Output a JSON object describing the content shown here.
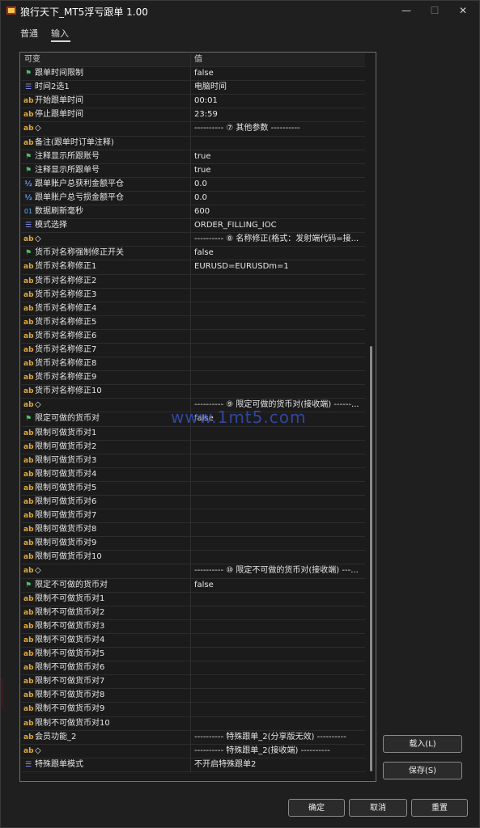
{
  "window": {
    "title": "狼行天下_MT5浮亏跟单 1.00",
    "min_glyph": "—",
    "max_glyph": "☐",
    "close_glyph": "✕"
  },
  "tabs": [
    {
      "label": "普通"
    },
    {
      "label": "输入"
    }
  ],
  "table": {
    "headers": [
      "可变",
      "值"
    ],
    "rows": [
      {
        "icon": "flag",
        "name": "跟单时间限制",
        "value": "false"
      },
      {
        "icon": "enum",
        "name": "时间2选1",
        "value": "电脑时间"
      },
      {
        "icon": "ab",
        "name": "开始跟单时间",
        "value": "00:01"
      },
      {
        "icon": "ab",
        "name": "停止跟单时间",
        "value": "23:59"
      },
      {
        "icon": "ab",
        "name": "◇",
        "value": "---------- ⑦ 其他参数 ----------"
      },
      {
        "icon": "ab",
        "name": "备注(跟单时订单注释)",
        "value": ""
      },
      {
        "icon": "flag",
        "name": "注释显示所跟账号",
        "value": "true"
      },
      {
        "icon": "flag",
        "name": "注释显示所跟单号",
        "value": "true"
      },
      {
        "icon": "half",
        "name": "跟单账户总获利金额平仓",
        "value": "0.0"
      },
      {
        "icon": "half",
        "name": "跟单账户总亏损金额平仓",
        "value": "0.0"
      },
      {
        "icon": "num",
        "name": "数据刷新毫秒",
        "value": "600"
      },
      {
        "icon": "enum",
        "name": "模式选择",
        "value": "ORDER_FILLING_IOC"
      },
      {
        "icon": "ab",
        "name": "◇",
        "value": "---------- ⑧ 名称修正(格式：发射端代码=接..."
      },
      {
        "icon": "flag",
        "name": "货币对名称强制修正开关",
        "value": "false"
      },
      {
        "icon": "ab",
        "name": "货币对名称修正1",
        "value": "EURUSD=EURUSDm=1"
      },
      {
        "icon": "ab",
        "name": "货币对名称修正2",
        "value": ""
      },
      {
        "icon": "ab",
        "name": "货币对名称修正3",
        "value": ""
      },
      {
        "icon": "ab",
        "name": "货币对名称修正4",
        "value": ""
      },
      {
        "icon": "ab",
        "name": "货币对名称修正5",
        "value": ""
      },
      {
        "icon": "ab",
        "name": "货币对名称修正6",
        "value": ""
      },
      {
        "icon": "ab",
        "name": "货币对名称修正7",
        "value": ""
      },
      {
        "icon": "ab",
        "name": "货币对名称修正8",
        "value": ""
      },
      {
        "icon": "ab",
        "name": "货币对名称修正9",
        "value": ""
      },
      {
        "icon": "ab",
        "name": "货币对名称修正10",
        "value": ""
      },
      {
        "icon": "ab",
        "name": "◇",
        "value": "---------- ⑨ 限定可做的货币对(接收端) ------..."
      },
      {
        "icon": "flag",
        "name": "限定可做的货币对",
        "value": "false"
      },
      {
        "icon": "ab",
        "name": "限制可做货币对1",
        "value": ""
      },
      {
        "icon": "ab",
        "name": "限制可做货币对2",
        "value": ""
      },
      {
        "icon": "ab",
        "name": "限制可做货币对3",
        "value": ""
      },
      {
        "icon": "ab",
        "name": "限制可做货币对4",
        "value": ""
      },
      {
        "icon": "ab",
        "name": "限制可做货币对5",
        "value": ""
      },
      {
        "icon": "ab",
        "name": "限制可做货币对6",
        "value": ""
      },
      {
        "icon": "ab",
        "name": "限制可做货币对7",
        "value": ""
      },
      {
        "icon": "ab",
        "name": "限制可做货币对8",
        "value": ""
      },
      {
        "icon": "ab",
        "name": "限制可做货币对9",
        "value": ""
      },
      {
        "icon": "ab",
        "name": "限制可做货币对10",
        "value": ""
      },
      {
        "icon": "ab",
        "name": "◇",
        "value": "---------- ⑩ 限定不可做的货币对(接收端) ---..."
      },
      {
        "icon": "flag",
        "name": "限定不可做的货币对",
        "value": "false"
      },
      {
        "icon": "ab",
        "name": "限制不可做货币对1",
        "value": ""
      },
      {
        "icon": "ab",
        "name": "限制不可做货币对2",
        "value": ""
      },
      {
        "icon": "ab",
        "name": "限制不可做货币对3",
        "value": ""
      },
      {
        "icon": "ab",
        "name": "限制不可做货币对4",
        "value": ""
      },
      {
        "icon": "ab",
        "name": "限制不可做货币对5",
        "value": ""
      },
      {
        "icon": "ab",
        "name": "限制不可做货币对6",
        "value": ""
      },
      {
        "icon": "ab",
        "name": "限制不可做货币对7",
        "value": ""
      },
      {
        "icon": "ab",
        "name": "限制不可做货币对8",
        "value": ""
      },
      {
        "icon": "ab",
        "name": "限制不可做货币对9",
        "value": ""
      },
      {
        "icon": "ab",
        "name": "限制不可做货币对10",
        "value": ""
      },
      {
        "icon": "ab",
        "name": "会员功能_2",
        "value": "---------- 特殊跟单_2(分享版无效) ----------"
      },
      {
        "icon": "ab",
        "name": "◇",
        "value": "---------- 特殊跟单_2(接收端) ----------"
      },
      {
        "icon": "enum",
        "name": "特殊跟单模式",
        "value": "不开启特殊跟单2"
      }
    ]
  },
  "icons": {
    "ab": "ab",
    "flag": "⚑",
    "enum": "☰",
    "half": "½",
    "num": "01"
  },
  "watermark": "www.1mt5.com",
  "buttons": {
    "load": "载入(L)",
    "save": "保存(S)",
    "ok": "确定",
    "cancel": "取消",
    "reset": "重置"
  }
}
